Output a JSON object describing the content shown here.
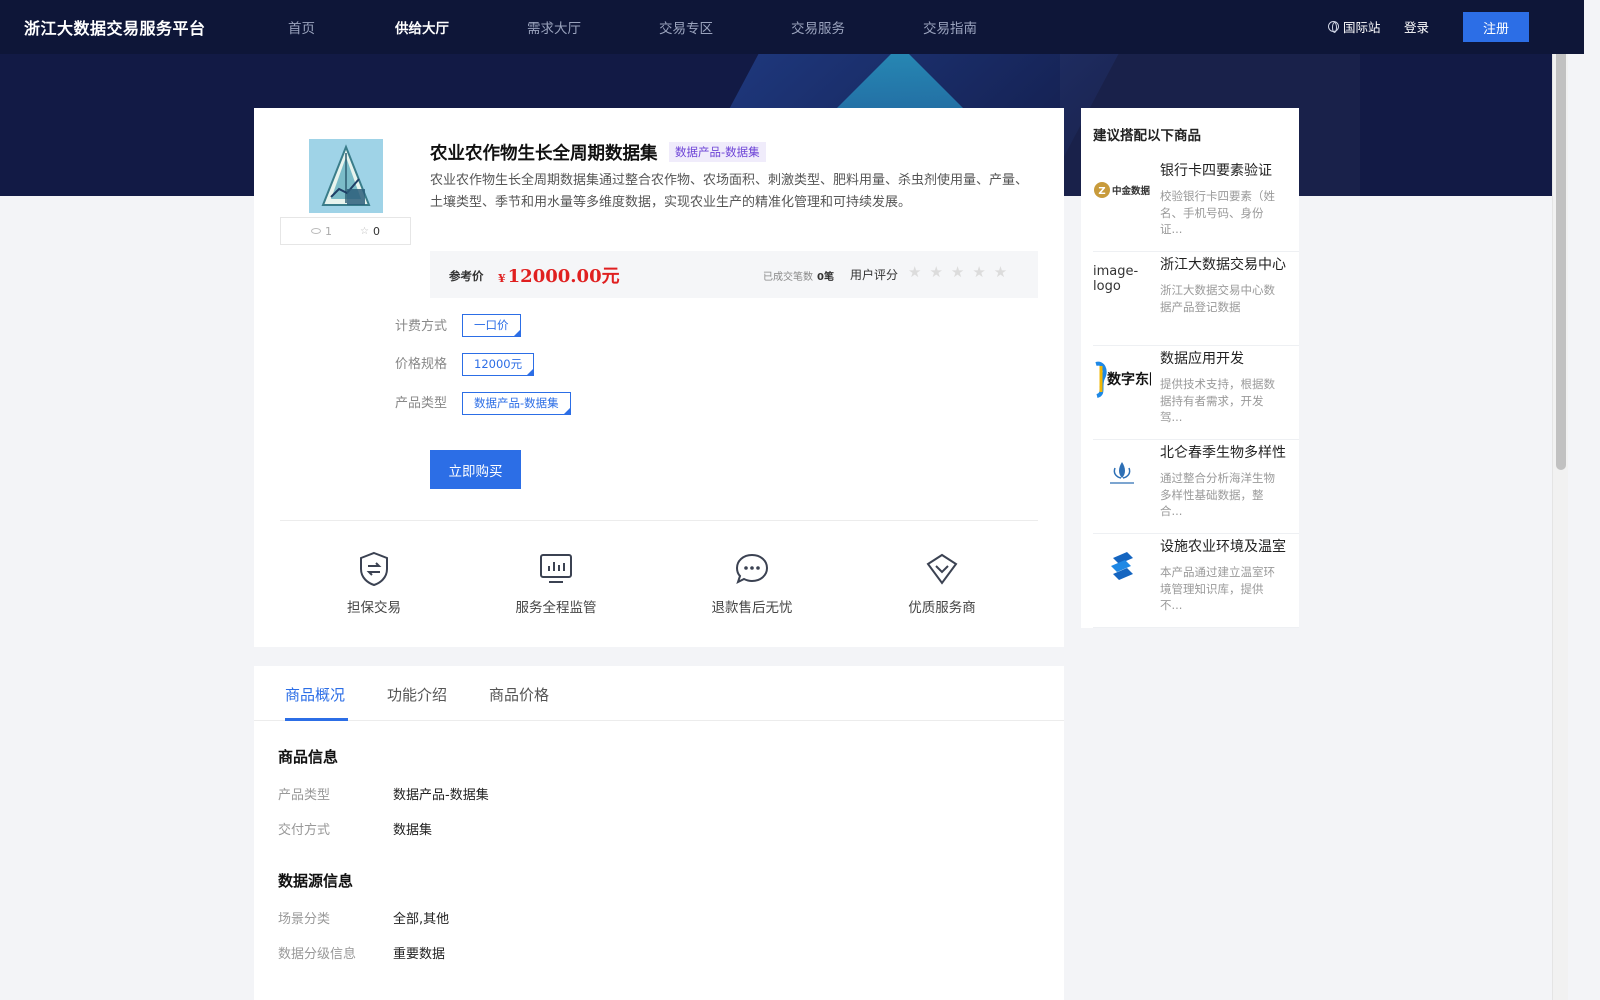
{
  "header": {
    "brand": "浙江大数据交易服务平台",
    "nav": [
      "首页",
      "供给大厅",
      "需求大厅",
      "交易专区",
      "交易服务",
      "交易指南"
    ],
    "active_nav": "供给大厅",
    "intl": "国际站",
    "login": "登录",
    "register": "注册"
  },
  "product": {
    "title": "农业农作物生长全周期数据集",
    "tag": "数据产品-数据集",
    "description": "农业农作物生长全周期数据集通过整合农作物、农场面积、刺激类型、肥料用量、杀虫剂使用量、产量、土壤类型、季节和用水量等多维度数据，实现农业生产的精准化管理和可持续发展。",
    "views": "1",
    "favorites": "0",
    "price_label": "参考价",
    "currency": "¥",
    "price": "12000.00元",
    "deals_label": "已成交笔数",
    "deals": "0笔",
    "rating_label": "用户评分",
    "rating": 0,
    "rating_max": 5,
    "stars": "★★★★★",
    "options": [
      {
        "label": "计费方式",
        "value": "一口价"
      },
      {
        "label": "价格规格",
        "value": "12000元"
      },
      {
        "label": "产品类型",
        "value": "数据产品-数据集"
      }
    ],
    "buy_label": "立即购买",
    "features": [
      {
        "label": "担保交易",
        "icon": "shield-exchange-icon"
      },
      {
        "label": "服务全程监管",
        "icon": "monitor-chart-icon"
      },
      {
        "label": "退款售后无忧",
        "icon": "chat-bubble-icon"
      },
      {
        "label": "优质服务商",
        "icon": "diamond-icon"
      }
    ]
  },
  "recommend": {
    "title": "建议搭配以下商品",
    "items": [
      {
        "name": "银行卡四要素验证",
        "desc": "校验银行卡四要素（姓名、手机号码、身份证...",
        "logo_text": "中金数据",
        "icon": "zhongjin-logo-icon"
      },
      {
        "name": "浙江大数据交易中心",
        "desc": "浙江大数据交易中心数据产品登记数据",
        "logo_text": "image-logo",
        "icon": "broken-image-icon"
      },
      {
        "name": "数据应用开发",
        "desc": "提供技术支持，根据数据持有者需求，开发驾...",
        "logo_text": "数字东阳",
        "icon": "shuzi-dongyang-logo-icon"
      },
      {
        "name": "北仑春季生物多样性",
        "desc": "通过整合分析海洋生物多样性基础数据，整合...",
        "logo_text": "",
        "icon": "ocean-logo-icon"
      },
      {
        "name": "设施农业环境及温室",
        "desc": "本产品通过建立温室环境管理知识库，提供不...",
        "logo_text": "",
        "icon": "s-logo-icon"
      }
    ]
  },
  "details": {
    "tabs": [
      "商品概况",
      "功能介绍",
      "商品价格"
    ],
    "active_tab": "商品概况",
    "sections": [
      {
        "title": "商品信息",
        "rows": [
          {
            "k": "产品类型",
            "v": "数据产品-数据集"
          },
          {
            "k": "交付方式",
            "v": "数据集"
          }
        ]
      },
      {
        "title": "数据源信息",
        "rows": [
          {
            "k": "场景分类",
            "v": "全部,其他"
          },
          {
            "k": "数据分级信息",
            "v": "重要数据"
          }
        ]
      }
    ]
  },
  "colors": {
    "nav_bg": "#0e1638",
    "accent": "#2c6ee6",
    "price": "#e02020",
    "tag_bg": "#f0ecfb",
    "tag_text": "#6d43d6"
  }
}
